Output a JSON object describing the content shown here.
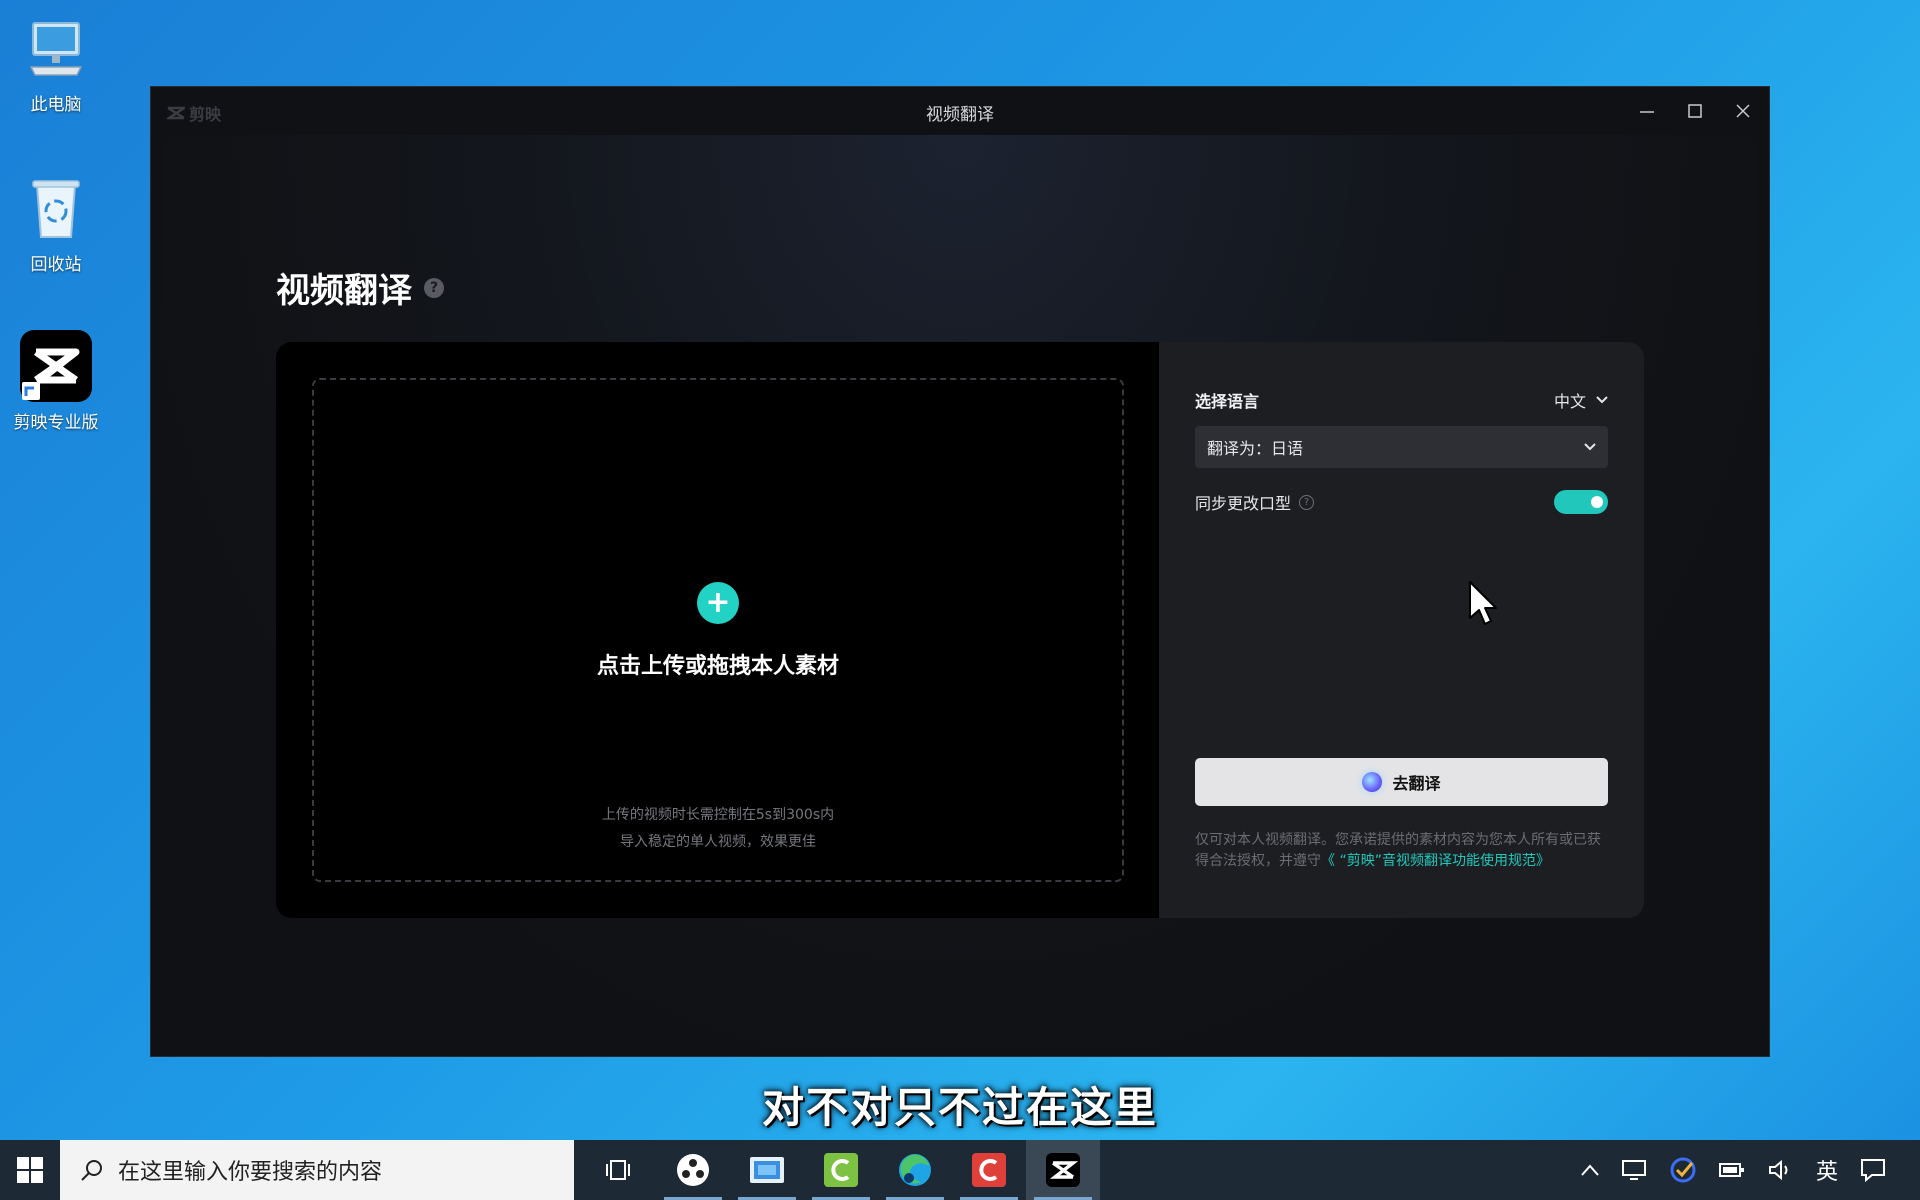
{
  "desktop": {
    "icons": [
      {
        "label": "此电脑",
        "icon": "computer-icon"
      },
      {
        "label": "回收站",
        "icon": "recycle-bin-icon"
      },
      {
        "label": "剪映专业版",
        "icon": "capcut-icon"
      }
    ]
  },
  "window": {
    "brand": "剪映",
    "title": "视频翻译"
  },
  "page": {
    "title": "视频翻译",
    "help": "?"
  },
  "upload": {
    "plus": "+",
    "prompt": "点击上传或拖拽本人素材",
    "hint_line1": "上传的视频时长需控制在5s到300s内",
    "hint_line2": "导入稳定的单人视频，效果更佳"
  },
  "settings": {
    "language_label": "选择语言",
    "source_language": "中文",
    "target_select": "翻译为：日语",
    "lip_sync_label": "同步更改口型",
    "lip_sync_on": true,
    "go_button": "去翻译",
    "disclaimer_text": "仅可对本人视频翻译。您承诺提供的素材内容为您本人所有或已获得合法授权，并遵守",
    "disclaimer_link": "《 “剪映”音视频翻译功能使用规范》"
  },
  "subtitle": "对不对只不过在这里",
  "taskbar": {
    "search_placeholder": "在这里输入你要搜索的内容",
    "ime": "英"
  },
  "colors": {
    "accent": "#22d3c5",
    "toggle": "#22c7bb",
    "desktop": "#1e9ae6"
  }
}
